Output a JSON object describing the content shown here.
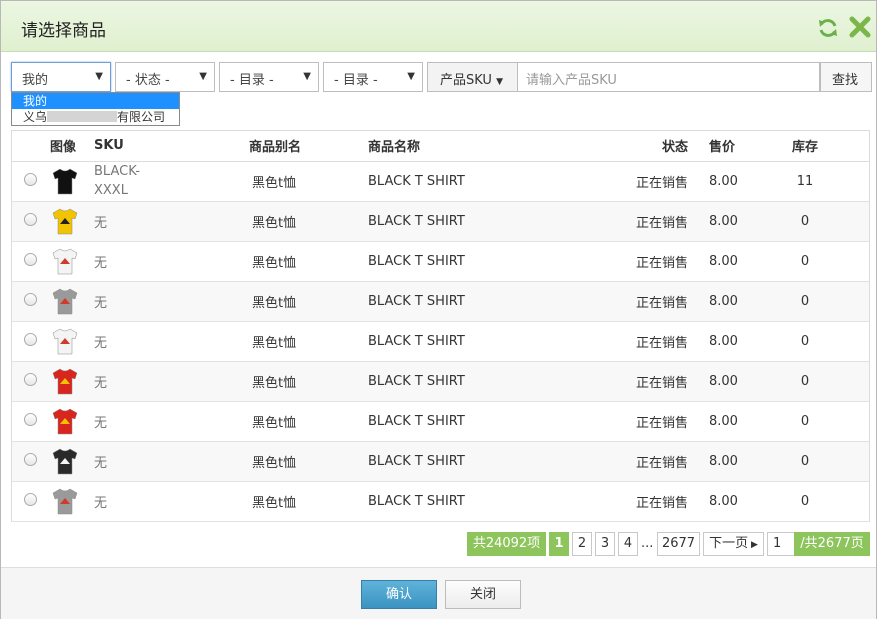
{
  "dialog": {
    "title": "请选择商品"
  },
  "filters": {
    "owner_select": "我的",
    "status_select": "- 状态 -",
    "catalog_select_1": "- 目录 -",
    "catalog_select_2": "- 目录 -",
    "sku_button": "产品SKU",
    "sku_placeholder": "请输入产品SKU",
    "search_button": "查找"
  },
  "owner_dropdown": {
    "options": [
      {
        "label": "我的"
      },
      {
        "prefix": "义乌",
        "suffix": "有限公司"
      }
    ]
  },
  "table": {
    "headers": {
      "image": "图像",
      "sku": "SKU",
      "alias": "商品别名",
      "name": "商品名称",
      "status": "状态",
      "price": "售价",
      "stock": "库存"
    },
    "rows": [
      {
        "sku": "BLACK-XXXL",
        "alias": "黑色t恤",
        "name": "BLACK T SHIRT",
        "status": "正在销售",
        "price": "8.00",
        "stock": "11",
        "shirt": "black-plain"
      },
      {
        "sku": "无",
        "alias": "黑色t恤",
        "name": "BLACK T SHIRT",
        "status": "正在销售",
        "price": "8.00",
        "stock": "0",
        "shirt": "yellow"
      },
      {
        "sku": "无",
        "alias": "黑色t恤",
        "name": "BLACK T SHIRT",
        "status": "正在销售",
        "price": "8.00",
        "stock": "0",
        "shirt": "white"
      },
      {
        "sku": "无",
        "alias": "黑色t恤",
        "name": "BLACK T SHIRT",
        "status": "正在销售",
        "price": "8.00",
        "stock": "0",
        "shirt": "gray"
      },
      {
        "sku": "无",
        "alias": "黑色t恤",
        "name": "BLACK T SHIRT",
        "status": "正在销售",
        "price": "8.00",
        "stock": "0",
        "shirt": "white"
      },
      {
        "sku": "无",
        "alias": "黑色t恤",
        "name": "BLACK T SHIRT",
        "status": "正在销售",
        "price": "8.00",
        "stock": "0",
        "shirt": "red"
      },
      {
        "sku": "无",
        "alias": "黑色t恤",
        "name": "BLACK T SHIRT",
        "status": "正在销售",
        "price": "8.00",
        "stock": "0",
        "shirt": "red"
      },
      {
        "sku": "无",
        "alias": "黑色t恤",
        "name": "BLACK T SHIRT",
        "status": "正在销售",
        "price": "8.00",
        "stock": "0",
        "shirt": "black"
      },
      {
        "sku": "无",
        "alias": "黑色t恤",
        "name": "BLACK T SHIRT",
        "status": "正在销售",
        "price": "8.00",
        "stock": "0",
        "shirt": "gray"
      }
    ]
  },
  "pagination": {
    "total": "共24092项",
    "pages": [
      "1",
      "2",
      "3",
      "4"
    ],
    "ellipsis": "...",
    "last_page": "2677",
    "next": "下一页",
    "goto_value": "1",
    "total_pages": "/共2677页"
  },
  "footer": {
    "confirm": "确认",
    "close": "关闭"
  },
  "colors": {
    "header_bg": "#e4f3d5",
    "pager_green": "#8dc45c",
    "confirm_blue": "#4aa3cf",
    "dropdown_highlight": "#1e90ff",
    "refresh_icon": "#6ab04c",
    "close_icon": "#7ab648"
  },
  "shirt_colors": {
    "black-plain": {
      "body": "#111111",
      "logo": ""
    },
    "yellow": {
      "body": "#f2c300",
      "logo": "#222222"
    },
    "white": {
      "body": "#f4f4f4",
      "logo": "#d23a2a"
    },
    "gray": {
      "body": "#9a9a9a",
      "logo": "#d23a2a"
    },
    "red": {
      "body": "#d8251d",
      "logo": "#f2c300"
    },
    "black": {
      "body": "#2a2a2a",
      "logo": "#f4f4f4"
    }
  }
}
